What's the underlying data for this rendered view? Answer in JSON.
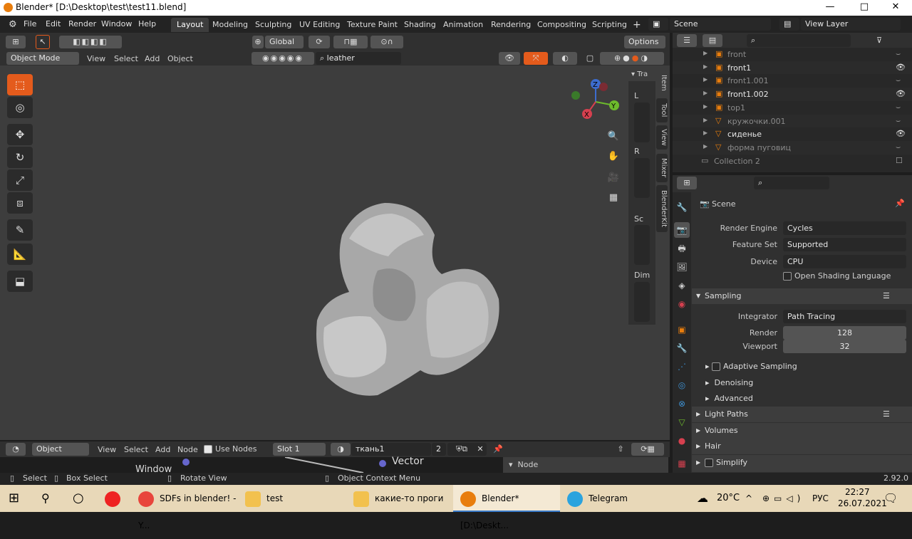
{
  "window": {
    "title": "Blender* [D:\\Desktop\\test\\test11.blend]",
    "min": "—",
    "max": "□",
    "close": "✕"
  },
  "menu": [
    "File",
    "Edit",
    "Render",
    "Window",
    "Help"
  ],
  "workspaces": [
    "Layout",
    "Modeling",
    "Sculpting",
    "UV Editing",
    "Texture Paint",
    "Shading",
    "Animation",
    "Rendering",
    "Compositing",
    "Scripting"
  ],
  "scene_label": "Scene",
  "view_layer_label": "View Layer",
  "toolbar": {
    "orientation": "Global",
    "options": "Options",
    "material_search": "leather"
  },
  "viewport_header": {
    "mode": "Object Mode",
    "items": [
      "View",
      "Select",
      "Add",
      "Object"
    ]
  },
  "npanel": {
    "tabs": [
      "Item",
      "Tool",
      "View",
      "Mixer",
      "BlenderKit"
    ],
    "labels": [
      "Tra",
      "L",
      "R",
      "Sc",
      "Dim"
    ]
  },
  "outliner": {
    "rows": [
      {
        "name": "front",
        "dim": true,
        "eye": false
      },
      {
        "name": "front1",
        "dim": false,
        "eye": true
      },
      {
        "name": "front1.001",
        "dim": true,
        "eye": false
      },
      {
        "name": "front1.002",
        "dim": false,
        "eye": true
      },
      {
        "name": "top1",
        "dim": true,
        "eye": false
      },
      {
        "name": "кружочки.001",
        "dim": true,
        "eye": false
      },
      {
        "name": "сиденье",
        "dim": false,
        "eye": true
      },
      {
        "name": "форма пуговиц",
        "dim": true,
        "eye": false
      },
      {
        "name": "Collection 2",
        "dim": true,
        "eye": false
      }
    ]
  },
  "properties": {
    "title": "Scene",
    "render_engine_label": "Render Engine",
    "render_engine": "Cycles",
    "feature_set_label": "Feature Set",
    "feature_set": "Supported",
    "device_label": "Device",
    "device": "CPU",
    "osl_label": "Open Shading Language",
    "sampling": "Sampling",
    "integrator_label": "Integrator",
    "integrator": "Path Tracing",
    "render_label": "Render",
    "render_samples": "128",
    "viewport_label": "Viewport",
    "viewport_samples": "32",
    "adaptive": "Adaptive Sampling",
    "denoising": "Denoising",
    "advanced": "Advanced",
    "light_paths": "Light Paths",
    "volumes": "Volumes",
    "hair": "Hair",
    "simplify": "Simplify"
  },
  "node_editor": {
    "type": "Object",
    "items": [
      "View",
      "Select",
      "Add",
      "Node"
    ],
    "use_nodes": "Use Nodes",
    "slot": "Slot 1",
    "material": "ткань1",
    "users": "2",
    "window_label": "Window",
    "vector_label": "Vector",
    "node_panel": "Node"
  },
  "statusbar": {
    "select": "Select",
    "box_select": "Box Select",
    "rotate": "Rotate View",
    "context": "Object Context Menu",
    "version": "2.92.0"
  },
  "taskbar": {
    "items": [
      "SDFs in blender! - Y...",
      "test",
      "какие-то проги",
      "Blender* [D:\\Deskt...",
      "Telegram"
    ],
    "weather": "20°C",
    "lang": "РУС",
    "time": "22:27",
    "date": "26.07.2021"
  },
  "colors": {
    "accent": "#e45b1c",
    "blender": "#e87d0d",
    "active_tab": "#3d3d3d"
  }
}
